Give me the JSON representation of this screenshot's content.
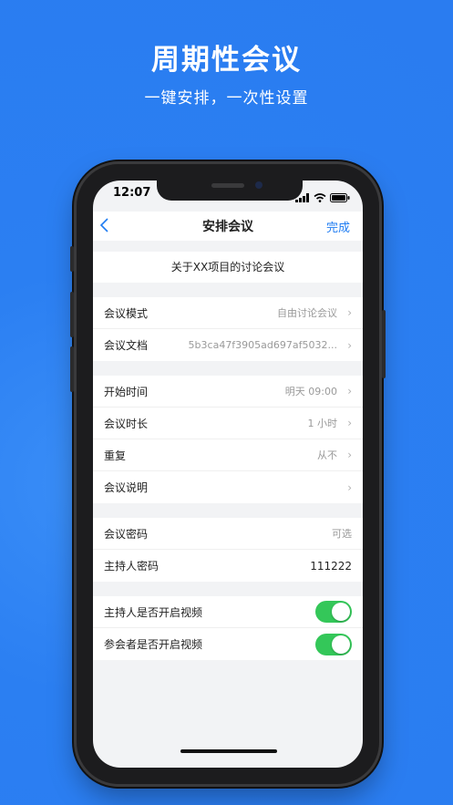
{
  "promo": {
    "headline": "周期性会议",
    "subline": "一键安排，一次性设置"
  },
  "status_bar": {
    "time": "12:07"
  },
  "nav": {
    "back_icon": "chevron-left-icon",
    "title": "安排会议",
    "done_label": "完成"
  },
  "meeting": {
    "topic": "关于XX项目的讨论会议"
  },
  "groups": {
    "mode": {
      "label": "会议模式",
      "value": "自由讨论会议"
    },
    "doc": {
      "label": "会议文档",
      "value": "5b3ca47f3905ad697af5032..."
    },
    "start": {
      "label": "开始时间",
      "value": "明天 09:00"
    },
    "duration": {
      "label": "会议时长",
      "value": "1 小时"
    },
    "repeat": {
      "label": "重复",
      "value": "从不"
    },
    "desc": {
      "label": "会议说明",
      "value": ""
    },
    "password": {
      "label": "会议密码",
      "placeholder": "可选"
    },
    "host_password": {
      "label": "主持人密码",
      "value": "111222"
    },
    "host_video": {
      "label": "主持人是否开启视频",
      "on": true
    },
    "attendee_video": {
      "label": "参会者是否开启视频",
      "on": true
    }
  },
  "colors": {
    "accent": "#1f7cf2",
    "toggle_on": "#34c759",
    "background": "#2a7cf0"
  }
}
